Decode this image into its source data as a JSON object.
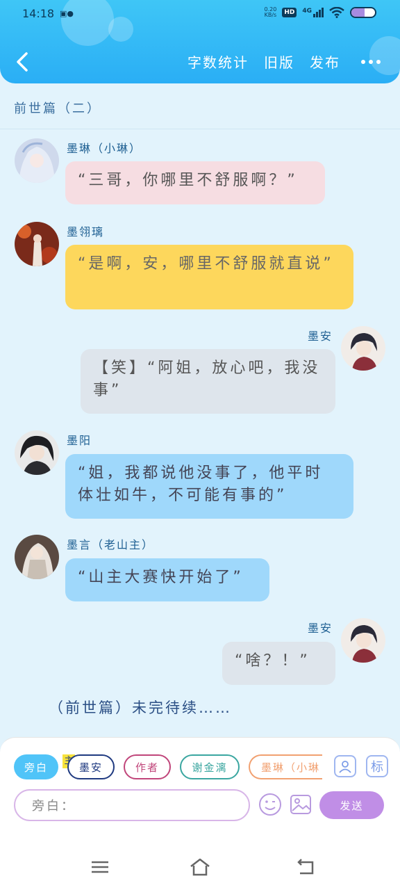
{
  "status_bar": {
    "time": "14:18",
    "net_speed_top": "0.20",
    "net_speed_bottom": "KB/s",
    "hd": "HD",
    "network": "4G",
    "battery_level": 0.55
  },
  "header": {
    "word_count_label": "字数统计",
    "old_version_label": "旧版",
    "publish_label": "发布",
    "back_icon": "chevron-left-icon",
    "more_icon": "more-dots-icon"
  },
  "chapter_title": "前世篇（二）",
  "messages": [
    {
      "speaker": "墨琳（小琳）",
      "text": "“三哥，你哪里不舒服啊？”",
      "side": "left",
      "color": "#f6dde2"
    },
    {
      "speaker": "墨翎璃",
      "text": "“是啊，安，哪里不舒服就直说”",
      "side": "left",
      "color": "#fdd75c"
    },
    {
      "speaker": "墨安",
      "text": "【笑】“阿姐，放心吧，我没事”",
      "side": "right",
      "color": "#dee5ec"
    },
    {
      "speaker": "墨阳",
      "text": "“姐，我都说他没事了，他平时体壮如牛，不可能有事的”",
      "side": "left",
      "color": "#9fd8fb"
    },
    {
      "speaker": "墨言（老山主）",
      "text": "“山主大赛快开始了”",
      "side": "left",
      "color": "#9fd8fb"
    },
    {
      "speaker": "墨安",
      "text": "“啥？！”",
      "side": "right",
      "color": "#dee5ec"
    }
  ],
  "to_be_continued": "（前世篇）未完待续……",
  "composer": {
    "roles": [
      "旁白",
      "墨安",
      "作者",
      "谢金漓",
      "墨琳（小琳"
    ],
    "main_tag": "主",
    "input_placeholder": "旁白：",
    "send_label": "发送",
    "tag_button": "标"
  },
  "colors": {
    "header": "#2aaef5",
    "send": "#c08ee6",
    "accent": "#50c4f8"
  }
}
